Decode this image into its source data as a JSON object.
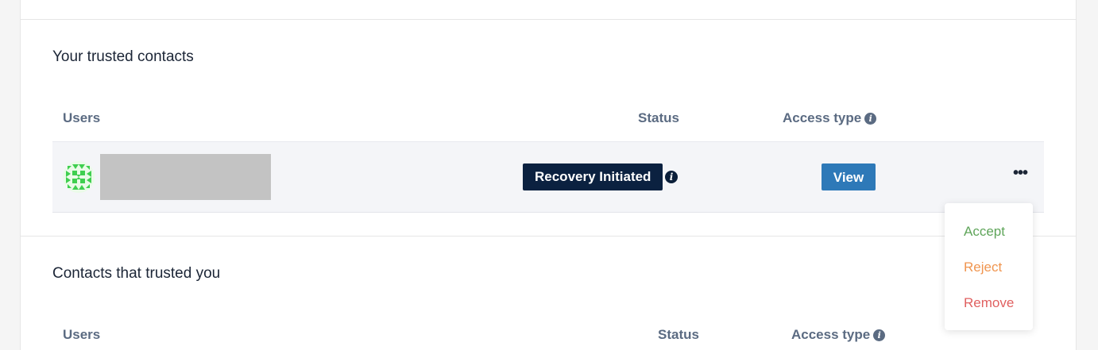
{
  "trusted_contacts": {
    "title": "Your trusted contacts",
    "columns": {
      "users": "Users",
      "status": "Status",
      "access_type": "Access type"
    },
    "rows": [
      {
        "status": "Recovery Initiated",
        "access_label": "View",
        "more": "•••"
      }
    ]
  },
  "contacts_that_trusted_you": {
    "title": "Contacts that trusted you",
    "columns": {
      "users": "Users",
      "status": "Status",
      "access_type": "Access type"
    }
  },
  "row_menu": {
    "items": [
      {
        "label": "Accept",
        "color": "#5fa55a"
      },
      {
        "label": "Reject",
        "color": "#f0954f"
      },
      {
        "label": "Remove",
        "color": "#e06060"
      }
    ]
  },
  "icons": {
    "info": "info-icon",
    "more": "ellipsis-icon",
    "avatar": "identicon-avatar"
  },
  "colors": {
    "badge": "#0b2140",
    "view_button": "#2e79b8",
    "avatar_green": "#3fcf4f"
  }
}
